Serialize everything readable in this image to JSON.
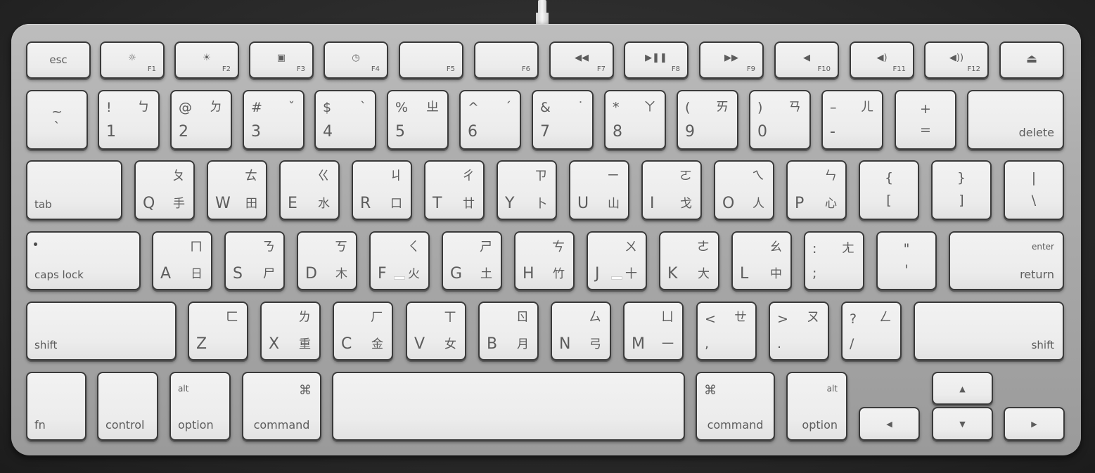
{
  "description": "Photo of an Apple aluminum compact keyboard with Zhuyin (Bopomofo) and Cangjie legends",
  "colors": {
    "background": "#2c2c2c",
    "keyboard_body": "#aeaeae",
    "keycap": "#eeeeee",
    "legend": "#5c5c5c"
  },
  "function_row": [
    {
      "id": "esc",
      "label": "esc"
    },
    {
      "id": "f1",
      "label": "F1",
      "icon": "brightness-down-icon",
      "glyph": "☼"
    },
    {
      "id": "f2",
      "label": "F2",
      "icon": "brightness-up-icon",
      "glyph": "☀"
    },
    {
      "id": "f3",
      "label": "F3",
      "icon": "expose-icon",
      "glyph": "▣"
    },
    {
      "id": "f4",
      "label": "F4",
      "icon": "dashboard-icon",
      "glyph": "◷"
    },
    {
      "id": "f5",
      "label": "F5"
    },
    {
      "id": "f6",
      "label": "F6"
    },
    {
      "id": "f7",
      "label": "F7",
      "icon": "rewind-icon",
      "glyph": "◀◀"
    },
    {
      "id": "f8",
      "label": "F8",
      "icon": "play-pause-icon",
      "glyph": "▶❚❚"
    },
    {
      "id": "f9",
      "label": "F9",
      "icon": "fast-forward-icon",
      "glyph": "▶▶"
    },
    {
      "id": "f10",
      "label": "F10",
      "icon": "mute-icon",
      "glyph": "◀"
    },
    {
      "id": "f11",
      "label": "F11",
      "icon": "volume-down-icon",
      "glyph": "◀)"
    },
    {
      "id": "f12",
      "label": "F12",
      "icon": "volume-up-icon",
      "glyph": "◀))"
    },
    {
      "id": "eject",
      "label": "",
      "icon": "eject-icon",
      "glyph": "⏏"
    }
  ],
  "number_row": [
    {
      "id": "backtick",
      "shift": "~",
      "base": "`",
      "zhuyin": ""
    },
    {
      "id": "1",
      "shift": "!",
      "base": "1",
      "zhuyin": "ㄅ"
    },
    {
      "id": "2",
      "shift": "@",
      "base": "2",
      "zhuyin": "ㄉ"
    },
    {
      "id": "3",
      "shift": "#",
      "base": "3",
      "zhuyin": "ˇ"
    },
    {
      "id": "4",
      "shift": "$",
      "base": "4",
      "zhuyin": "ˋ"
    },
    {
      "id": "5",
      "shift": "%",
      "base": "5",
      "zhuyin": "ㄓ"
    },
    {
      "id": "6",
      "shift": "^",
      "base": "6",
      "zhuyin": "ˊ"
    },
    {
      "id": "7",
      "shift": "&",
      "base": "7",
      "zhuyin": "˙"
    },
    {
      "id": "8",
      "shift": "*",
      "base": "8",
      "zhuyin": "ㄚ"
    },
    {
      "id": "9",
      "shift": "(",
      "base": "9",
      "zhuyin": "ㄞ"
    },
    {
      "id": "0",
      "shift": ")",
      "base": "0",
      "zhuyin": "ㄢ"
    },
    {
      "id": "minus",
      "shift": "–",
      "base": "-",
      "zhuyin": "ㄦ"
    },
    {
      "id": "equals",
      "shift": "+",
      "base": "=",
      "zhuyin": ""
    },
    {
      "id": "delete",
      "label": "delete"
    }
  ],
  "top_row": [
    {
      "id": "tab",
      "label": "tab"
    },
    {
      "id": "q",
      "letter": "Q",
      "zhuyin": "ㄆ",
      "cangjie": "手"
    },
    {
      "id": "w",
      "letter": "W",
      "zhuyin": "ㄊ",
      "cangjie": "田"
    },
    {
      "id": "e",
      "letter": "E",
      "zhuyin": "ㄍ",
      "cangjie": "水"
    },
    {
      "id": "r",
      "letter": "R",
      "zhuyin": "ㄐ",
      "cangjie": "口"
    },
    {
      "id": "t",
      "letter": "T",
      "zhuyin": "ㄔ",
      "cangjie": "廿"
    },
    {
      "id": "y",
      "letter": "Y",
      "zhuyin": "ㄗ",
      "cangjie": "卜"
    },
    {
      "id": "u",
      "letter": "U",
      "zhuyin": "ㄧ",
      "cangjie": "山"
    },
    {
      "id": "i",
      "letter": "I",
      "zhuyin": "ㄛ",
      "cangjie": "戈"
    },
    {
      "id": "o",
      "letter": "O",
      "zhuyin": "ㄟ",
      "cangjie": "人"
    },
    {
      "id": "p",
      "letter": "P",
      "zhuyin": "ㄣ",
      "cangjie": "心"
    },
    {
      "id": "lbracket",
      "shift": "{",
      "base": "["
    },
    {
      "id": "rbracket",
      "shift": "}",
      "base": "]"
    },
    {
      "id": "backslash",
      "shift": "|",
      "base": "\\"
    }
  ],
  "home_row": [
    {
      "id": "capslock",
      "label": "caps lock"
    },
    {
      "id": "a",
      "letter": "A",
      "zhuyin": "ㄇ",
      "cangjie": "日"
    },
    {
      "id": "s",
      "letter": "S",
      "zhuyin": "ㄋ",
      "cangjie": "尸"
    },
    {
      "id": "d",
      "letter": "D",
      "zhuyin": "ㄎ",
      "cangjie": "木"
    },
    {
      "id": "f",
      "letter": "F",
      "zhuyin": "ㄑ",
      "cangjie": "火",
      "homing": true
    },
    {
      "id": "g",
      "letter": "G",
      "zhuyin": "ㄕ",
      "cangjie": "土"
    },
    {
      "id": "h",
      "letter": "H",
      "zhuyin": "ㄘ",
      "cangjie": "竹"
    },
    {
      "id": "j",
      "letter": "J",
      "zhuyin": "ㄨ",
      "cangjie": "十",
      "homing": true
    },
    {
      "id": "k",
      "letter": "K",
      "zhuyin": "ㄜ",
      "cangjie": "大"
    },
    {
      "id": "l",
      "letter": "L",
      "zhuyin": "ㄠ",
      "cangjie": "中"
    },
    {
      "id": "semicolon",
      "shift": ":",
      "base": ";",
      "zhuyin": "ㄤ"
    },
    {
      "id": "quote",
      "shift": "\"",
      "base": "'"
    },
    {
      "id": "return",
      "top": "enter",
      "label": "return"
    }
  ],
  "bottom_row": [
    {
      "id": "lshift",
      "label": "shift"
    },
    {
      "id": "z",
      "letter": "Z",
      "zhuyin": "ㄈ",
      "cangjie": ""
    },
    {
      "id": "x",
      "letter": "X",
      "zhuyin": "ㄌ",
      "cangjie": "重"
    },
    {
      "id": "c",
      "letter": "C",
      "zhuyin": "ㄏ",
      "cangjie": "金"
    },
    {
      "id": "v",
      "letter": "V",
      "zhuyin": "ㄒ",
      "cangjie": "女"
    },
    {
      "id": "b",
      "letter": "B",
      "zhuyin": "ㄖ",
      "cangjie": "月"
    },
    {
      "id": "n",
      "letter": "N",
      "zhuyin": "ㄙ",
      "cangjie": "弓"
    },
    {
      "id": "m",
      "letter": "M",
      "zhuyin": "ㄩ",
      "cangjie": "一"
    },
    {
      "id": "comma",
      "shift": "<",
      "base": ",",
      "zhuyin": "ㄝ"
    },
    {
      "id": "period",
      "shift": ">",
      "base": ".",
      "zhuyin": "ㄡ"
    },
    {
      "id": "slash",
      "shift": "?",
      "base": "/",
      "zhuyin": "ㄥ"
    },
    {
      "id": "rshift",
      "label": "shift"
    }
  ],
  "modifier_row": [
    {
      "id": "fn",
      "label": "fn"
    },
    {
      "id": "control",
      "label": "control"
    },
    {
      "id": "loption",
      "top": "alt",
      "label": "option"
    },
    {
      "id": "lcommand",
      "top": "⌘",
      "label": "command"
    },
    {
      "id": "space",
      "label": ""
    },
    {
      "id": "rcommand",
      "top": "⌘",
      "label": "command"
    },
    {
      "id": "roption",
      "top": "alt",
      "label": "option"
    }
  ],
  "arrows": [
    {
      "id": "up",
      "glyph": "▲"
    },
    {
      "id": "left",
      "glyph": "◀"
    },
    {
      "id": "down",
      "glyph": "▼"
    },
    {
      "id": "right",
      "glyph": "▶"
    }
  ]
}
